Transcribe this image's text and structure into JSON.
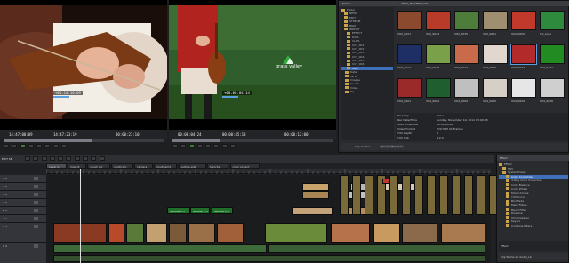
{
  "player": {
    "overlay_timecode": "+01:14:10:09",
    "in_timecode": "14:47:00:09",
    "out_timecode": "14:47:23:19",
    "duration": "00:00:23:10"
  },
  "recorder": {
    "overlay_timecode": "+00:00:04:14",
    "in_timecode": "00:00:04:24",
    "out_timecode": "00:00:45:13",
    "duration": "00:00:12:00",
    "logo_text": "grass valley"
  },
  "bin": {
    "header_left": "Folder",
    "header_right": "3DR2_MASTER_CLIP",
    "tree": [
      "Folder",
      "NEWS",
      "EDIT",
      "STREAM",
      "BGM",
      "IMPORT",
      "EFFECT",
      "DATA",
      "CLIPS",
      "CUT_001",
      "CUT_002",
      "CUT_003",
      "CUT_004",
      "CUT_005",
      "CUT_006",
      "MOV",
      "Data",
      "INFO",
      "Images",
      "Sound",
      "Video",
      "Prj"
    ],
    "thumbnails": [
      "V02_0021",
      "V02_0034",
      "V02_0035",
      "V02_0041",
      "V02_0050",
      "GV_Logo",
      "V03_0012",
      "V03_0018",
      "V03_0022",
      "V03_0030",
      "V03_0037",
      "V03_0041",
      "V04_0001",
      "V04_0004",
      "V04_0009",
      "V04_0015",
      "V04_0020",
      "V04_0026"
    ],
    "thumb_colors": [
      "#8b4a2e",
      "#b83b2a",
      "#4e7c3a",
      "#9f8e6f",
      "#c0392b",
      "#2e8b3d",
      "#1e2f66",
      "#7aa04a",
      "#c96a4a",
      "#e0d8cf",
      "#b22a2a",
      "#228b22",
      "#9a2a2a",
      "#1f5f2f",
      "#bfbfbf",
      "#d5cfc5",
      "#e6e6e6",
      "#cfcfcf"
    ],
    "properties": [
      [
        "Property",
        "Value"
      ],
      [
        "Rec Date/Time",
        "Sunday, November 19, 2011 13:00:08"
      ],
      [
        "Start Timecode",
        "00:00:00;00"
      ],
      [
        "Video Format",
        "720 HHP 21 Frames"
      ],
      [
        "YUV Depth",
        "8"
      ],
      [
        "YUV Sub",
        "4:2:2"
      ]
    ],
    "tab_clip_marker": "Clip marker",
    "tab_source_browser": "Source Browser"
  },
  "timeline": {
    "title": "EDIT SE",
    "tabs": [
      "Layer A",
      "main B",
      "rough cut",
      "multicam",
      "camera",
      "multicam2",
      "outline edit",
      "favorite",
      "color correct"
    ],
    "track_labels": [
      "1 V",
      "2 V",
      "3 V",
      "4 V",
      "5 V",
      "A 1",
      "A 2",
      "A 3"
    ],
    "title_clip_text": "SOUND E.3"
  },
  "effects": {
    "header": "Effect",
    "items": [
      "Effect",
      "SDV",
      "SystemPreset",
      "Color Correction",
      "3-Way Color Correction",
      "Color Balance",
      "Color Wheel",
      "Monochrome",
      "YUV Curve",
      "Blur/Fade",
      "Mask Filters",
      "Blend Filter",
      "Dissolve",
      "Chromakeyer",
      "Keyers",
      "Combine Filters"
    ],
    "selected_index": 3,
    "footer": "Effect",
    "sub_footer": "Clip Name 1 / Audio_Lb"
  }
}
